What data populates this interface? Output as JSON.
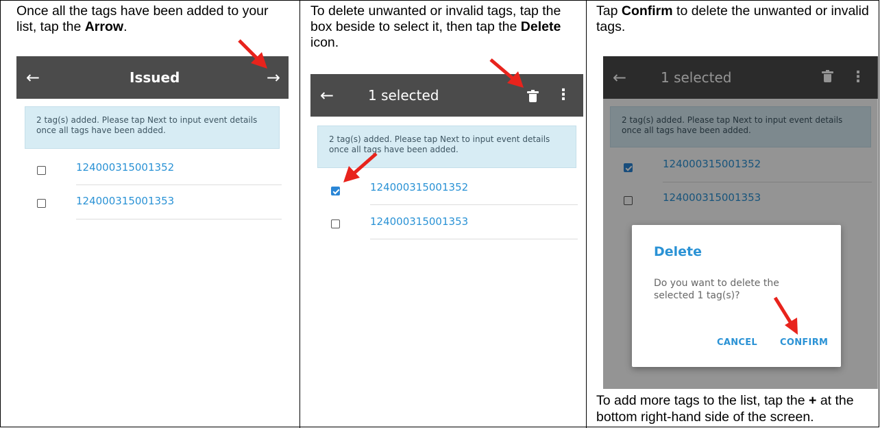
{
  "panels": [
    {
      "instruction": {
        "before": "Once all the tags have been added to your list, tap the ",
        "bold": "Arrow",
        "after": "."
      },
      "appbar": {
        "back_icon": "←",
        "title": "Issued",
        "forward_icon": "→"
      },
      "banner": "2 tag(s) added. Please tap Next to input event details once all tags have been added.",
      "tags": [
        {
          "number": "124000315001352",
          "checked": false
        },
        {
          "number": "124000315001353",
          "checked": false
        }
      ]
    },
    {
      "instruction": {
        "before": "To delete unwanted or invalid tags, tap the box beside to select it, then tap the ",
        "bold": "Delete",
        "after": " icon."
      },
      "appbar": {
        "back_icon": "←",
        "title": "1 selected",
        "more_icon": "⋮"
      },
      "banner": "2 tag(s) added. Please tap Next to input event details once all tags have been added.",
      "tags": [
        {
          "number": "124000315001352",
          "checked": true
        },
        {
          "number": "124000315001353",
          "checked": false
        }
      ]
    },
    {
      "instruction": {
        "before": "Tap ",
        "bold": "Confirm",
        "after": " to delete the unwanted or invalid tags."
      },
      "appbar": {
        "back_icon": "←",
        "title": "1 selected",
        "more_icon": "⋮"
      },
      "banner": "2 tag(s) added. Please tap Next to input event details once all tags have been added.",
      "tags": [
        {
          "number": "124000315001352",
          "checked": true
        },
        {
          "number": "124000315001353",
          "checked": false
        }
      ],
      "dialog": {
        "title": "Delete",
        "message": "Do you want to delete the selected 1 tag(s)?",
        "cancel": "CANCEL",
        "confirm": "CONFIRM"
      },
      "footer": {
        "before": " To add more tags to the list, tap the ",
        "bold": "+",
        "after": " at the bottom right-hand side of the screen."
      }
    }
  ],
  "colors": {
    "appbar": "#4b4b4b",
    "banner": "#d7ecf4",
    "link": "#2a92d5",
    "checkbox_checked": "#2a86d6",
    "arrow": "#e8231c"
  }
}
